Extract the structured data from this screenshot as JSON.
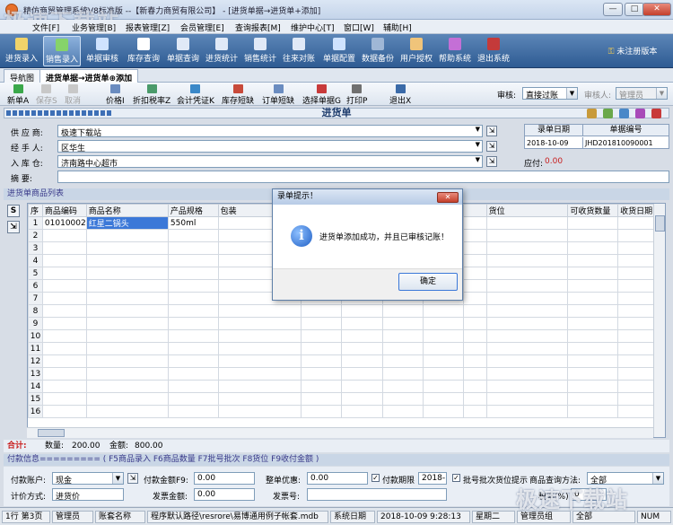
{
  "window": {
    "title": "精仿商贸管理系统V8标准版 --【新春力商贸有限公司】 - [进货单据→进货单+添加]",
    "watermark": "极速下载站"
  },
  "menubar": [
    "文件[F]",
    "业务管理[B]",
    "报表管理[Z]",
    "会员管理[E]",
    "查询报表[M]",
    "维护中心[T]",
    "窗口[W]",
    "辅助[H]"
  ],
  "toolbar": {
    "items": [
      "进货录入",
      "销售录入",
      "单据审核",
      "库存查询",
      "单据查询",
      "进货统计",
      "销售统计",
      "往来对账",
      "单据配置",
      "数据备份",
      "用户授权",
      "帮助系统",
      "退出系统"
    ],
    "register": "未注册版本"
  },
  "tabs": [
    "导航图",
    "进货单据→进货单⊕添加"
  ],
  "subtoolbar": {
    "items": [
      "新单A",
      "保存S",
      "取消",
      "价格I",
      "折扣税率Z",
      "会计凭证K",
      "库存短缺",
      "订单短缺",
      "选择单据G",
      "打印P",
      "退出X"
    ],
    "audit_label": "审核:",
    "audit_value": "直接过账",
    "auditor_label": "审核人:",
    "auditor_value": "管理员"
  },
  "form": {
    "title": "进货单",
    "supplier_label": "供 应 商:",
    "supplier": "极速下载站",
    "handler_label": "经 手 人:",
    "handler": "区华生",
    "warehouse_label": "入 库 仓:",
    "warehouse": "济南路中心超市",
    "summary_label": "摘    要:",
    "summary": "",
    "date_label": "录单日期",
    "date": "2018-10-09",
    "number_label": "单据编号",
    "number": "JHD201810090001",
    "payable_label": "应付:",
    "payable": "0.00"
  },
  "grid": {
    "section_title": "进货单商品列表",
    "columns": [
      "序",
      "商品编码",
      "商品名称",
      "产品规格",
      "包装",
      "",
      "",
      "",
      "",
      "",
      "货位",
      "可收货数量",
      "收货日期"
    ],
    "rows": [
      [
        "1",
        "01010002",
        "红星二锅头",
        "550ml",
        "",
        "",
        "",
        "",
        "",
        "",
        "",
        "",
        ""
      ],
      [
        "2"
      ],
      [
        "3"
      ],
      [
        "4"
      ],
      [
        "5"
      ],
      [
        "6"
      ],
      [
        "7"
      ],
      [
        "8"
      ],
      [
        "9"
      ],
      [
        "10"
      ],
      [
        "11"
      ],
      [
        "12"
      ],
      [
        "13"
      ],
      [
        "14"
      ],
      [
        "15"
      ],
      [
        "16"
      ]
    ]
  },
  "totals": {
    "label": "合计:",
    "qty_label": "数量:",
    "qty": "200.00",
    "amount_label": "金额:",
    "amount": "800.00"
  },
  "payment": {
    "header": "付款信息========= ( F5商品录入  F6商品数量  F7批号批次  F8货位  F9收付金额 )",
    "account_label": "付款账户:",
    "account": "现金",
    "amount_label": "付款金额F9:",
    "amount": "0.00",
    "discount_label": "整单优惠:",
    "discount": "0.00",
    "deadline_label": "付款期限",
    "deadline": "2018-",
    "batch_label": "批号批次货位提示",
    "query_label": "商品查询方法:",
    "query": "全部",
    "pricing_label": "计价方式:",
    "pricing": "进货价",
    "invoice_amount_label": "发票金额:",
    "invoice_amount": "0.00",
    "invoice_no_label": "发票号:",
    "invoice_no": "",
    "tax_label": "税率(%)",
    "tax": "0"
  },
  "statusbar": [
    "1行 第3页",
    "管理员",
    "账套名称",
    "程序默认路径\\resrore\\易博通用例子帐套.mdb",
    "系统日期",
    "2018-10-09  9:28:13",
    "星期二",
    "管理员组",
    "全部",
    "NUM"
  ],
  "dialog": {
    "title": "录单提示！",
    "message": "进货单添加成功，并且已审核记账！",
    "ok": "确定",
    "close": "✕"
  }
}
